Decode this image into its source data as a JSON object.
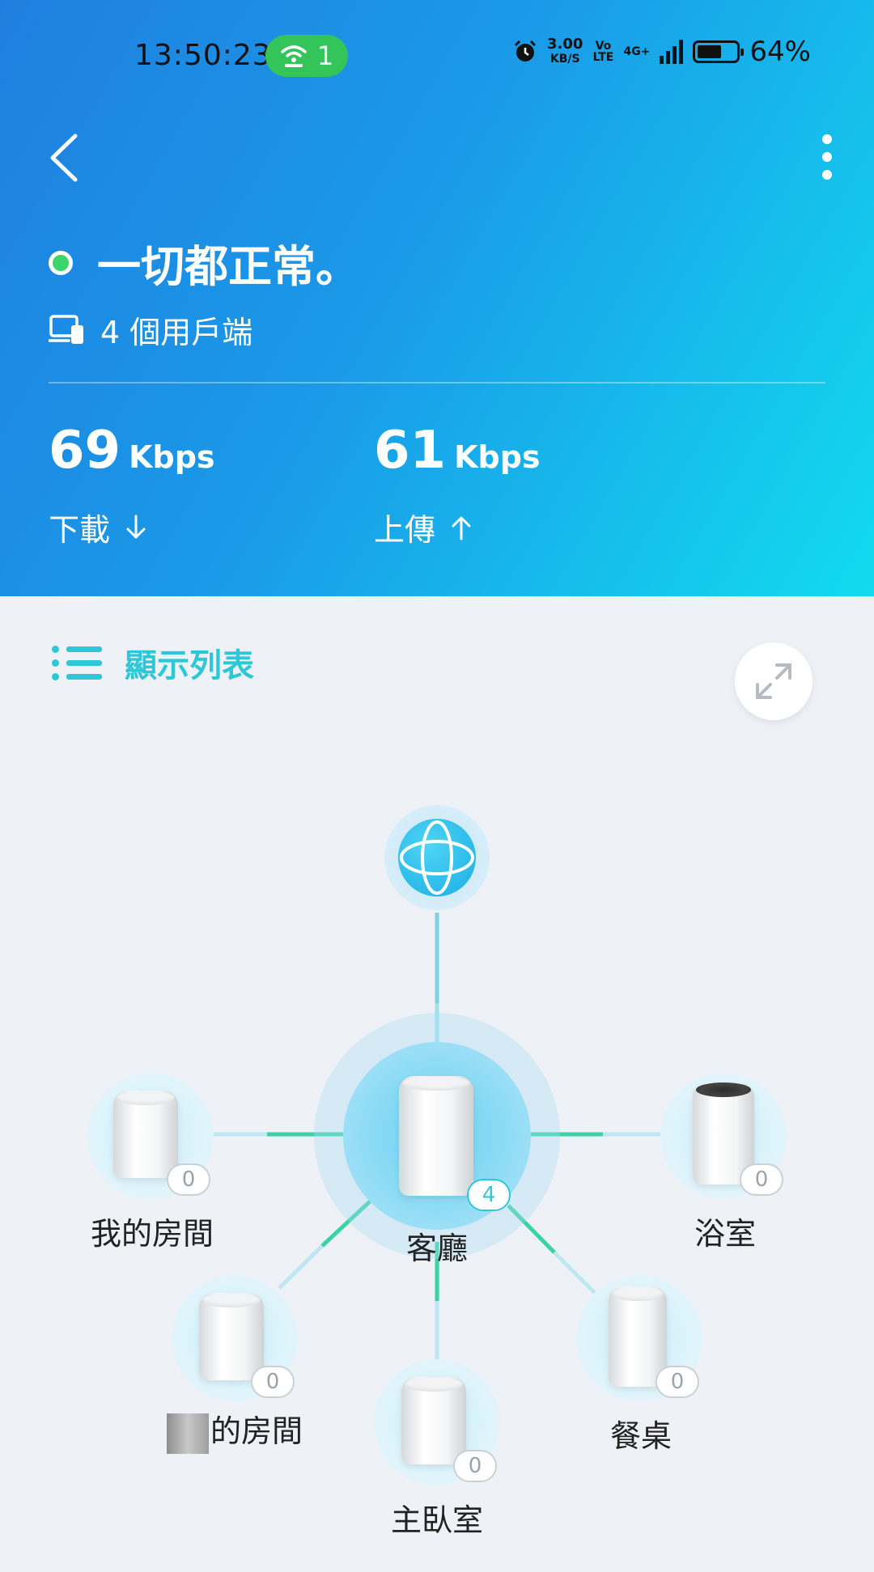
{
  "status_bar": {
    "time": "13:50:23",
    "hotspot_count": "1",
    "speed_value": "3.00",
    "speed_unit": "KB/S",
    "volte": "Vo LTE",
    "network": "4G+",
    "battery_percent": "64%",
    "battery_level": 0.64
  },
  "header": {
    "status_text": "一切都正常。",
    "clients_text": "4 個用戶端",
    "download": {
      "value": "69",
      "unit": "Kbps",
      "label": "下載"
    },
    "upload": {
      "value": "61",
      "unit": "Kbps",
      "label": "上傳"
    },
    "status_color": "#3ad66b"
  },
  "toolbar": {
    "list_label": "顯示列表"
  },
  "topology": {
    "hub": {
      "name": "客廳",
      "clients": "4"
    },
    "nodes": [
      {
        "name": "我的房間",
        "clients": "0"
      },
      {
        "name": "浴室",
        "clients": "0"
      },
      {
        "name": "的房間",
        "clients": "0"
      },
      {
        "name": "主臥室",
        "clients": "0"
      },
      {
        "name": "餐桌",
        "clients": "0"
      }
    ]
  },
  "colors": {
    "accent": "#2ec7d8",
    "link": "#3bd3a6",
    "header_start": "#1f7fe0",
    "header_end": "#12dbee"
  }
}
